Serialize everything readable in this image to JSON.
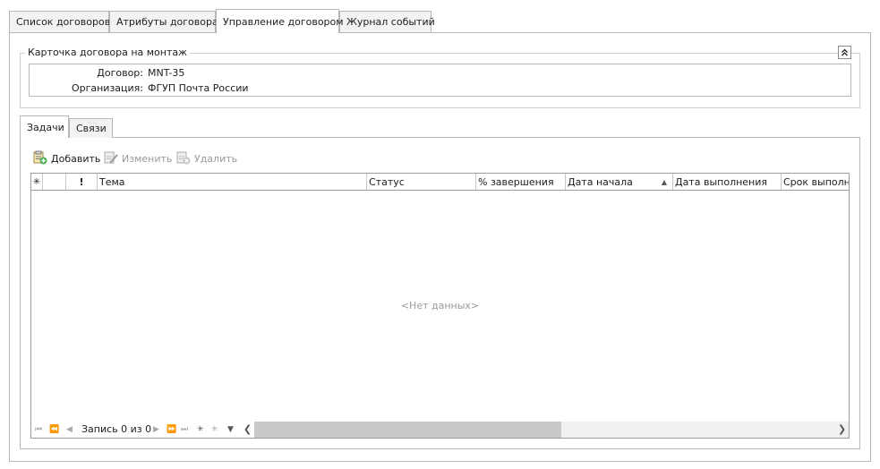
{
  "top_tabs": [
    "Список договоров",
    "Атрибуты договора",
    "Управление договором",
    "Журнал событий"
  ],
  "card": {
    "title": "Карточка договора на монтаж",
    "contract_label": "Договор:",
    "contract_value": "MNT-35",
    "org_label": "Организация:",
    "org_value": "ФГУП Почта России"
  },
  "inner_tabs": [
    "Задачи",
    "Связи"
  ],
  "toolbar": {
    "add": "Добавить",
    "edit": "Изменить",
    "delete": "Удалить"
  },
  "grid": {
    "columns": [
      "Тема",
      "Статус",
      "% завершения",
      "Дата начала",
      "Дата выполнения",
      "Срок выполнен"
    ],
    "empty_text": "<Нет данных>"
  },
  "navigator": {
    "record_text": "Запись 0 из 0"
  }
}
